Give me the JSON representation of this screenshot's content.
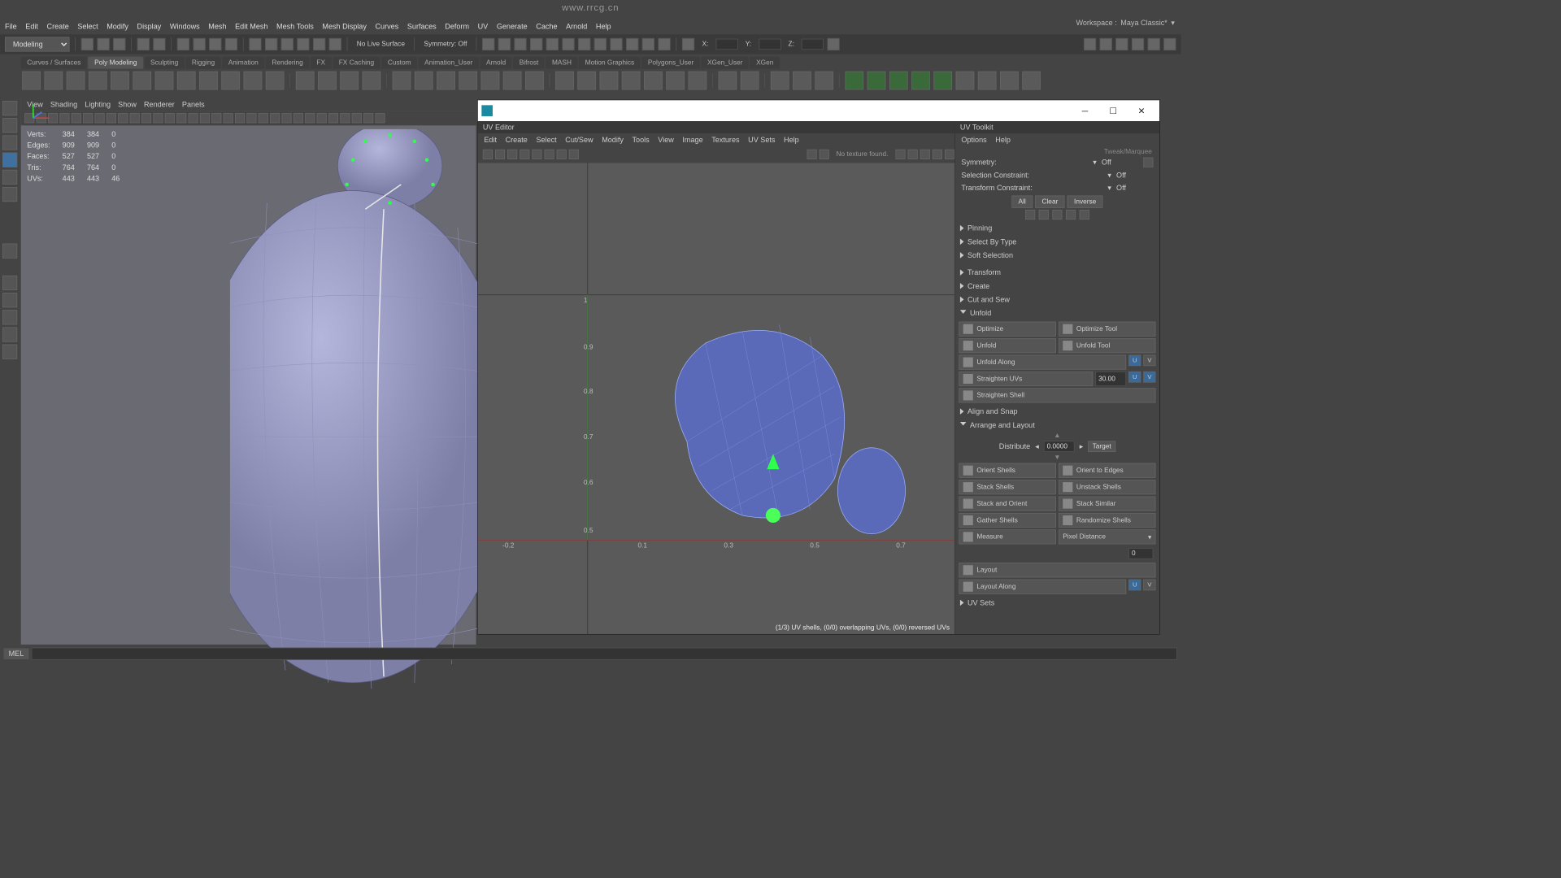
{
  "url_watermark": "www.rrcg.cn",
  "workspace": {
    "label": "Workspace :",
    "value": "Maya Classic*"
  },
  "menubar": [
    "File",
    "Edit",
    "Create",
    "Select",
    "Modify",
    "Display",
    "Windows",
    "Mesh",
    "Edit Mesh",
    "Mesh Tools",
    "Mesh Display",
    "Curves",
    "Surfaces",
    "Deform",
    "UV",
    "Generate",
    "Cache",
    "Arnold",
    "Help"
  ],
  "mode_dropdown": "Modeling",
  "statusline": {
    "live": "No Live Surface",
    "symmetry": "Symmetry: Off",
    "coords": {
      "xlabel": "X:",
      "ylabel": "Y:",
      "zlabel": "Z:"
    }
  },
  "shelf_tabs": [
    "Curves / Surfaces",
    "Poly Modeling",
    "Sculpting",
    "Rigging",
    "Animation",
    "Rendering",
    "FX",
    "FX Caching",
    "Custom",
    "Animation_User",
    "Arnold",
    "Bifrost",
    "MASH",
    "Motion Graphics",
    "Polygons_User",
    "XGen_User",
    "XGen"
  ],
  "shelf_active": "Poly Modeling",
  "viewport_menu": [
    "View",
    "Shading",
    "Lighting",
    "Show",
    "Renderer",
    "Panels"
  ],
  "hud": {
    "rows": [
      {
        "label": "Verts:",
        "a": "384",
        "b": "384",
        "c": "0"
      },
      {
        "label": "Edges:",
        "a": "909",
        "b": "909",
        "c": "0"
      },
      {
        "label": "Faces:",
        "a": "527",
        "b": "527",
        "c": "0"
      },
      {
        "label": "Tris:",
        "a": "764",
        "b": "764",
        "c": "0"
      },
      {
        "label": "UVs:",
        "a": "443",
        "b": "443",
        "c": "46"
      }
    ]
  },
  "uv_editor": {
    "title": "UV Editor",
    "menu": [
      "Edit",
      "Create",
      "Select",
      "Cut/Sew",
      "Modify",
      "Tools",
      "View",
      "Image",
      "Textures",
      "UV Sets",
      "Help"
    ],
    "texture_status": "No texture found.",
    "footer": "(1/3) UV shells, (0/0) overlapping UVs, (0/0) reversed UVs"
  },
  "uv_toolkit": {
    "title": "UV Toolkit",
    "menu": [
      "Options",
      "Help"
    ],
    "tweak": "Tweak/Marquee",
    "rows": {
      "symmetry": {
        "label": "Symmetry:",
        "value": "Off"
      },
      "selcon": {
        "label": "Selection Constraint:",
        "value": "Off"
      },
      "xformcon": {
        "label": "Transform Constraint:",
        "value": "Off"
      }
    },
    "selbtns": {
      "all": "All",
      "clear": "Clear",
      "inverse": "Inverse"
    },
    "sections": {
      "pinning": "Pinning",
      "selbytype": "Select By Type",
      "softsel": "Soft Selection",
      "transform": "Transform",
      "create": "Create",
      "cutsew": "Cut and Sew",
      "unfold": "Unfold",
      "align": "Align and Snap",
      "arrange": "Arrange and Layout",
      "uvsets": "UV Sets"
    },
    "unfold": {
      "optimize": "Optimize",
      "optimize_tool": "Optimize Tool",
      "unfold": "Unfold",
      "unfold_tool": "Unfold Tool",
      "unfold_along": "Unfold Along",
      "straighten_uvs": "Straighten UVs",
      "straighten_uvs_val": "30.00",
      "straighten_shell": "Straighten Shell",
      "u": "U",
      "v": "V"
    },
    "arrange": {
      "distribute": "Distribute",
      "dist_val": "0.0000",
      "target": "Target",
      "orient_shells": "Orient Shells",
      "orient_edges": "Orient to Edges",
      "stack_shells": "Stack Shells",
      "unstack_shells": "Unstack Shells",
      "stack_orient": "Stack and Orient",
      "stack_similar": "Stack Similar",
      "gather_shells": "Gather Shells",
      "randomize_shells": "Randomize Shells",
      "measure": "Measure",
      "pixel_distance": "Pixel Distance",
      "layout": "Layout",
      "layout_along": "Layout Along",
      "spacing_val": "0"
    }
  },
  "cmdline": {
    "lang": "MEL"
  }
}
